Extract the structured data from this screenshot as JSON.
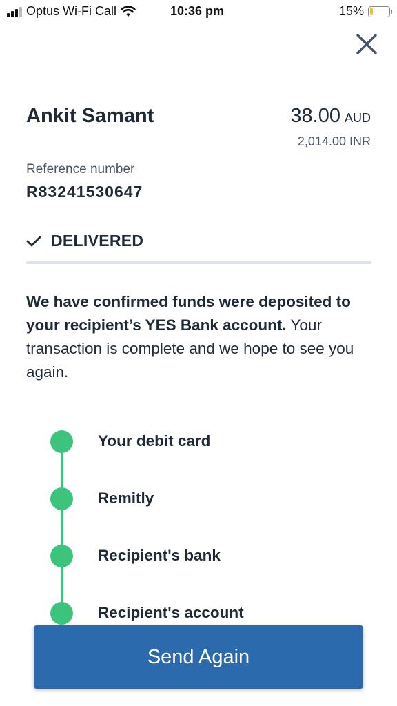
{
  "status_bar": {
    "carrier": "Optus Wi-Fi Call",
    "time": "10:36 pm",
    "battery": "15%",
    "battery_level": 0.15
  },
  "header": {
    "close_icon": "close-icon"
  },
  "transfer": {
    "recipient_name": "Ankit Samant",
    "send_amount": "38.00",
    "send_currency": "AUD",
    "receive_amount": "2,014.00 INR",
    "reference_label": "Reference number",
    "reference_number": "R83241530647",
    "status": "DELIVERED",
    "message_bold": "We have confirmed funds were deposited to your recipient’s YES Bank account.",
    "message_rest": " Your transaction is complete and we hope to see you again."
  },
  "timeline": {
    "color": "#3cc47c",
    "steps": [
      {
        "label": "Your debit card"
      },
      {
        "label": "Remitly"
      },
      {
        "label": "Recipient's bank"
      },
      {
        "label": "Recipient's account"
      }
    ]
  },
  "actions": {
    "send_again_label": "Send Again",
    "color": "#2a6aad"
  }
}
